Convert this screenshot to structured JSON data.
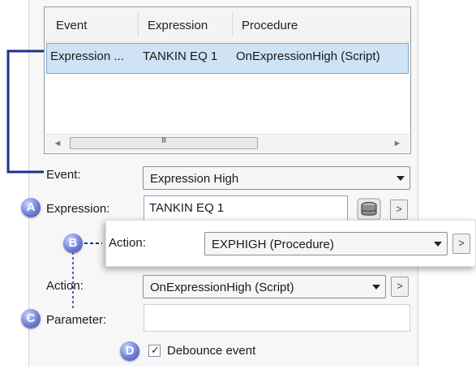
{
  "events_list": {
    "columns": [
      "Event",
      "Expression",
      "Procedure"
    ],
    "rows": [
      {
        "event": "Expression ...",
        "expression": "TANKIN EQ 1",
        "procedure": "OnExpressionHigh (Script)"
      }
    ],
    "scrollbar": {
      "left_arrow": "◄",
      "right_arrow": "►",
      "grip": "III"
    }
  },
  "form": {
    "event_label": "Event:",
    "event_value": "Expression High",
    "expression_label": "Expression:",
    "expression_value": "TANKIN EQ 1",
    "action_label": "Action:",
    "action_value": "OnExpressionHigh (Script)",
    "parameter_label": "Parameter:",
    "parameter_value": "",
    "debounce_label": "Debounce event",
    "debounce_checked": true,
    "more_button": ">"
  },
  "callout": {
    "action_label": "Action:",
    "action_value": "EXPHIGH (Procedure)",
    "more_button": ">"
  },
  "badges": {
    "a": "A",
    "b": "B",
    "c": "C",
    "d": "D"
  },
  "colors": {
    "accent_line": "#1e2f8c",
    "selection": "#cfe3f5",
    "badge": "#6f80d8"
  },
  "icons": {
    "expression_builder": "database-icon",
    "dropdown": "chevron-down-icon"
  }
}
